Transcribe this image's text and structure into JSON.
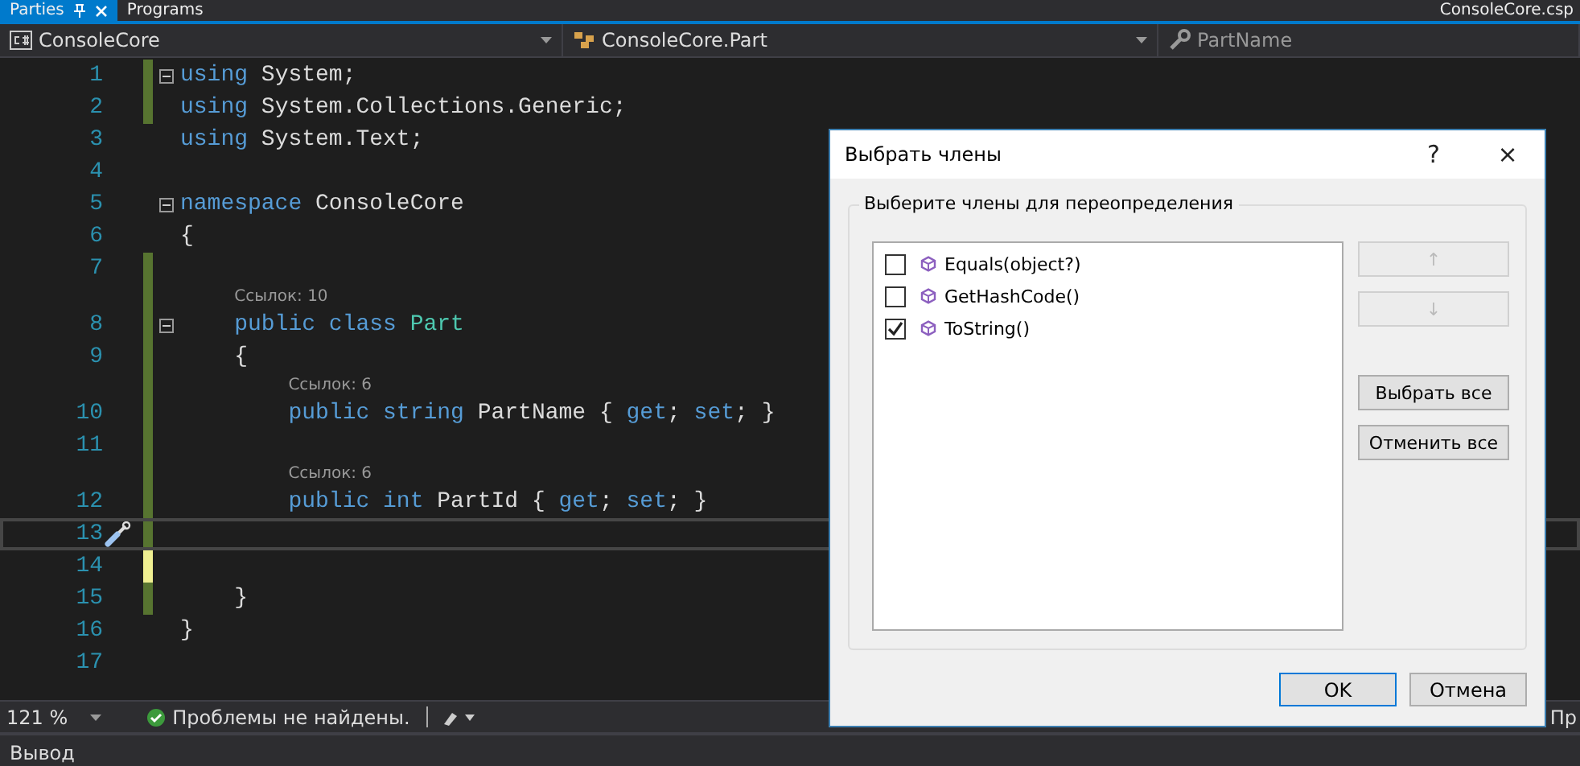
{
  "document_tabs": [
    {
      "label": "Parties",
      "selected": true
    },
    {
      "label": "Programs",
      "selected": false
    }
  ],
  "project_title": "ConsoleCore.csp",
  "navigation_bar": {
    "project": "ConsoleCore",
    "type": "ConsoleCore.Part",
    "member": "PartName"
  },
  "editor": {
    "lines": [
      {
        "number": "1",
        "fold": true,
        "modified": true,
        "saved": true,
        "current": false,
        "tokens": [
          {
            "kind": "keyword",
            "text": "using"
          },
          {
            "kind": "plain",
            "text": " System;"
          }
        ]
      },
      {
        "number": "2",
        "fold": false,
        "modified": true,
        "saved": true,
        "current": false,
        "tokens": [
          {
            "kind": "keyword",
            "text": "using"
          },
          {
            "kind": "plain",
            "text": " System.Collections.Generic;"
          }
        ]
      },
      {
        "number": "3",
        "fold": false,
        "modified": false,
        "current": false,
        "tokens": [
          {
            "kind": "keyword",
            "text": "using"
          },
          {
            "kind": "plain",
            "text": " System.Text;"
          }
        ]
      },
      {
        "number": "4",
        "fold": false,
        "modified": false,
        "current": false
      },
      {
        "number": "5",
        "fold": true,
        "modified": false,
        "current": false,
        "tokens": [
          {
            "kind": "keyword",
            "text": "namespace"
          },
          {
            "kind": "plain",
            "text": " ConsoleCore"
          }
        ]
      },
      {
        "number": "6",
        "fold": false,
        "modified": false,
        "current": false,
        "tokens": [
          {
            "kind": "plain",
            "text": "{"
          }
        ]
      },
      {
        "number": "7",
        "fold": false,
        "modified": true,
        "saved": true,
        "current": false
      },
      {
        "number": "8",
        "fold": true,
        "modified": true,
        "saved": true,
        "current": false,
        "lens": "Ссылок: 10",
        "tokens": [
          {
            "kind": "keyword",
            "text": "    public class"
          },
          {
            "kind": "type",
            "text": " Part"
          }
        ]
      },
      {
        "number": "9",
        "fold": false,
        "modified": true,
        "saved": true,
        "current": false,
        "tokens": [
          {
            "kind": "plain",
            "text": "    {"
          }
        ]
      },
      {
        "number": "10",
        "fold": false,
        "modified": true,
        "saved": true,
        "current": false,
        "lens": "Ссылок: 6",
        "tokens": [
          {
            "kind": "keyword",
            "text": "        public string"
          },
          {
            "kind": "plain",
            "text": " PartName { "
          },
          {
            "kind": "keyword",
            "text": "get"
          },
          {
            "kind": "plain",
            "text": "; "
          },
          {
            "kind": "keyword",
            "text": "set"
          },
          {
            "kind": "plain",
            "text": "; }"
          }
        ]
      },
      {
        "number": "11",
        "fold": false,
        "modified": true,
        "saved": true,
        "current": false
      },
      {
        "number": "12",
        "fold": false,
        "modified": true,
        "saved": true,
        "current": false,
        "lens": "Ссылок: 6",
        "tokens": [
          {
            "kind": "keyword",
            "text": "        public int"
          },
          {
            "kind": "plain",
            "text": " PartId { "
          },
          {
            "kind": "keyword",
            "text": "get"
          },
          {
            "kind": "plain",
            "text": "; "
          },
          {
            "kind": "keyword",
            "text": "set"
          },
          {
            "kind": "plain",
            "text": "; }"
          }
        ]
      },
      {
        "number": "13",
        "fold": false,
        "modified": true,
        "saved": true,
        "current": true,
        "quick_action": true
      },
      {
        "number": "14",
        "fold": false,
        "modified": true,
        "saved": false,
        "current": false
      },
      {
        "number": "15",
        "fold": false,
        "modified": true,
        "saved": true,
        "current": false,
        "tokens": [
          {
            "kind": "plain",
            "text": "    }"
          }
        ]
      },
      {
        "number": "16",
        "fold": false,
        "modified": false,
        "current": false,
        "tokens": [
          {
            "kind": "plain",
            "text": "}"
          }
        ]
      },
      {
        "number": "17",
        "fold": false,
        "modified": false,
        "current": false
      }
    ]
  },
  "status_bar": {
    "zoom": "121 %",
    "issues": "Проблемы не найдены.",
    "right_text": "Пр"
  },
  "output_panel": {
    "title": "Вывод"
  },
  "dialog": {
    "title": "Выбрать члены",
    "help": "?",
    "close": "×",
    "group_label": "Выберите члены для переопределения",
    "members": [
      {
        "label": "Equals(object?)",
        "checked": false
      },
      {
        "label": "GetHashCode()",
        "checked": false
      },
      {
        "label": "ToString()",
        "checked": true
      }
    ],
    "move_up": "↑",
    "move_down": "↓",
    "select_all": "Выбрать все",
    "deselect_all": "Отменить все",
    "ok": "OK",
    "cancel": "Отмена"
  }
}
